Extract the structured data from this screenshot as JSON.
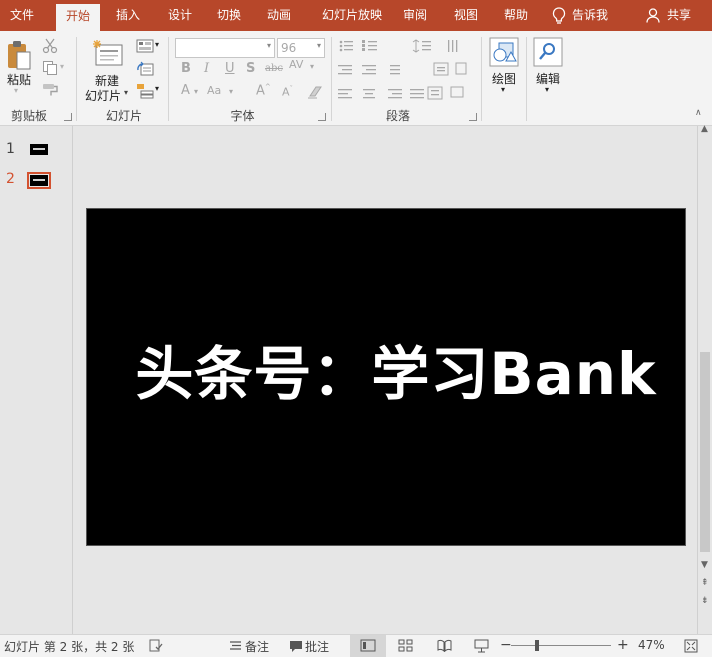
{
  "menu": {
    "tabs": [
      "文件",
      "开始",
      "插入",
      "设计",
      "切换",
      "动画",
      "幻灯片放映",
      "审阅",
      "视图",
      "帮助"
    ],
    "active_tab": "开始",
    "tell_me": "告诉我",
    "share": "共享"
  },
  "ribbon": {
    "clipboard": {
      "paste": "粘贴",
      "group": "剪贴板"
    },
    "slides": {
      "new_slide_line1": "新建",
      "new_slide_line2": "幻灯片",
      "group": "幻灯片"
    },
    "font": {
      "font_name": "",
      "font_size": "96",
      "group": "字体"
    },
    "paragraph": {
      "group": "段落"
    },
    "drawing": {
      "label": "绘图"
    },
    "editing": {
      "label": "编辑"
    }
  },
  "thumbnails": [
    {
      "number": "1",
      "selected": false
    },
    {
      "number": "2",
      "selected": true
    }
  ],
  "slide": {
    "title": "头条号：学习Bank"
  },
  "status": {
    "slide_info": "幻灯片 第 2 张，共 2 张",
    "notes": "备注",
    "comments": "批注",
    "zoom_minus": "−",
    "zoom_plus": "+",
    "zoom_level": "47%",
    "zoom_fraction": 0.47
  },
  "colors": {
    "accent": "#b7472a",
    "selected_thumb": "#d35230"
  }
}
